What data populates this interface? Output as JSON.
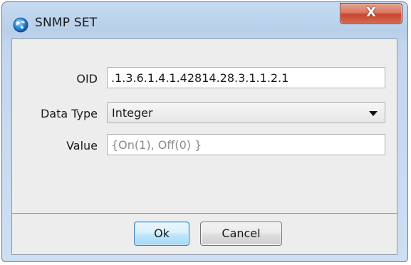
{
  "window": {
    "title": "SNMP SET",
    "app_icon": "globe-icon",
    "close_glyph": "X"
  },
  "form": {
    "oid_label": "OID",
    "oid_value": ".1.3.6.1.4.1.42814.28.3.1.1.2.1",
    "data_type_label": "Data Type",
    "data_type_value": "Integer",
    "value_label": "Value",
    "value_placeholder": "{On(1), Off(0) }"
  },
  "buttons": {
    "ok_label": "Ok",
    "cancel_label": "Cancel"
  },
  "colors": {
    "close_button": "#c94730",
    "ok_button_border": "#3c7fb1",
    "titlebar": "#b8cfea"
  }
}
